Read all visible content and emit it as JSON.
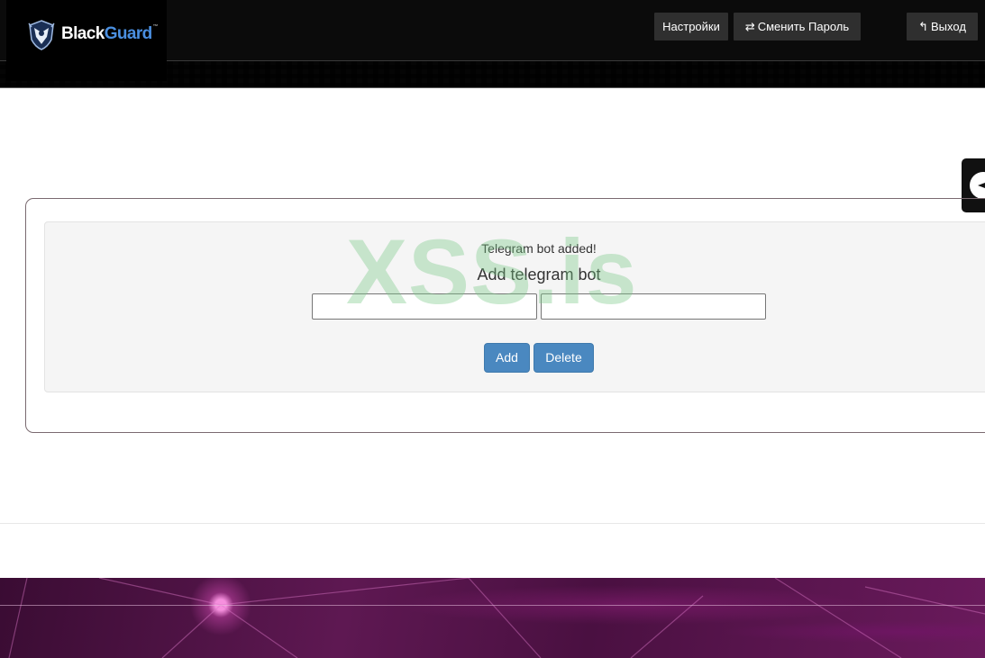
{
  "brand": {
    "name_part1": "Black",
    "name_part2": "Guard",
    "trademark": "™",
    "accent_color": "#4a8fe0"
  },
  "nav": {
    "settings_label": "Настройки",
    "change_password_label": "Сменить Пароль",
    "change_password_icon": "swap-arrows-icon",
    "logout_label": "Выход",
    "logout_icon": "reply-arrow-icon"
  },
  "panel": {
    "status_message": "Telegram bot added!",
    "title": "Add telegram bot",
    "field1_value": "",
    "field2_value": "",
    "add_label": "Add",
    "delete_label": "Delete",
    "button_color": "#4a88c0"
  },
  "watermark": "XSS.is"
}
